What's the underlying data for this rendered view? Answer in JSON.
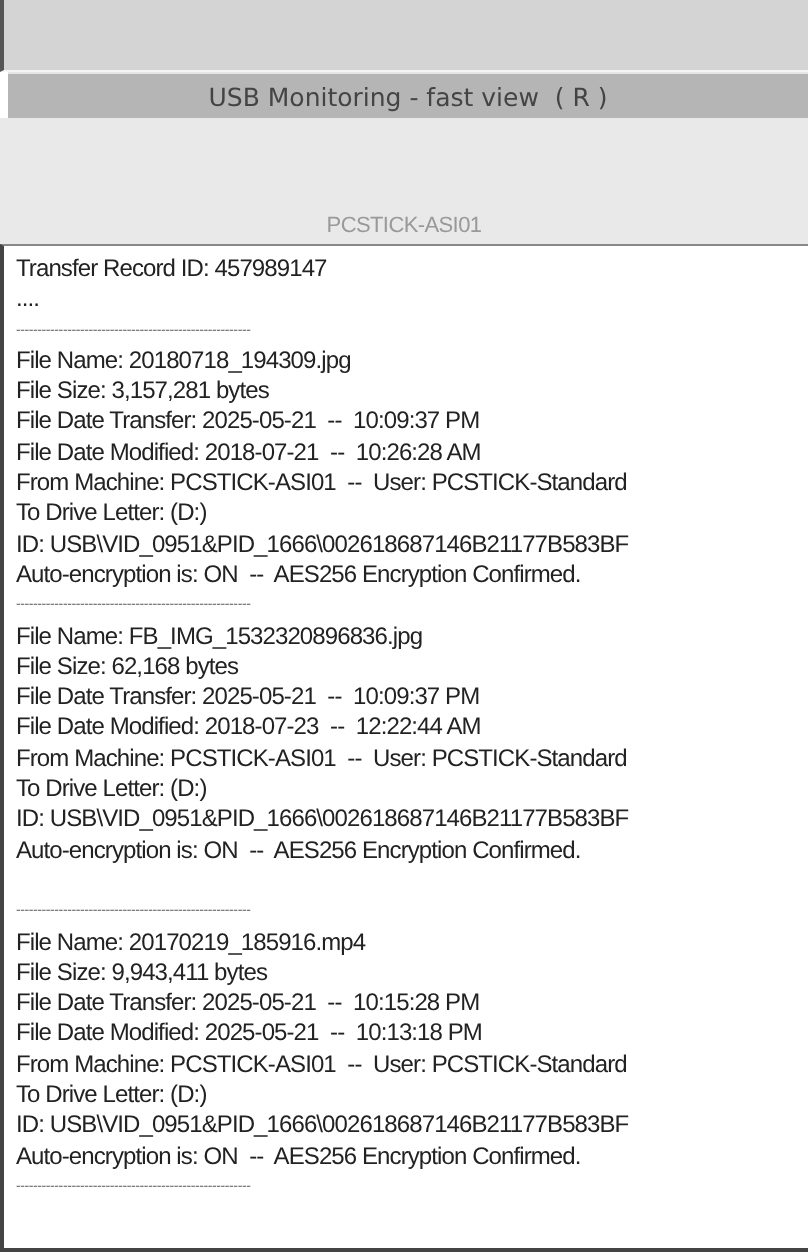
{
  "title_bar": {
    "title": "USB Monitoring - fast view  ( R )"
  },
  "machine_label": "PCSTICK-ASI01",
  "log_lines": [
    {
      "kind": "line",
      "text": "Transfer Record ID: 457989147"
    },
    {
      "kind": "line",
      "text": "...."
    },
    {
      "kind": "rule",
      "text": "-------------------------------------------------------"
    },
    {
      "kind": "line",
      "text": "File Name: 20180718_194309.jpg"
    },
    {
      "kind": "line",
      "text": "File Size: 3,157,281 bytes"
    },
    {
      "kind": "line",
      "text": "File Date Transfer: 2025-05-21  --  10:09:37 PM"
    },
    {
      "kind": "line",
      "text": "File Date Modified: 2018-07-21  --  10:26:28 AM"
    },
    {
      "kind": "line",
      "text": "From Machine: PCSTICK-ASI01  --  User: PCSTICK-Standard"
    },
    {
      "kind": "line",
      "text": "To Drive Letter: (D:)"
    },
    {
      "kind": "line",
      "text": "ID: USB\\VID_0951&PID_1666\\002618687146B21177B583BF"
    },
    {
      "kind": "line",
      "text": "Auto-encryption is: ON  --  AES256 Encryption Confirmed."
    },
    {
      "kind": "rule",
      "text": "-------------------------------------------------------"
    },
    {
      "kind": "line",
      "text": "File Name: FB_IMG_1532320896836.jpg"
    },
    {
      "kind": "line",
      "text": "File Size: 62,168 bytes"
    },
    {
      "kind": "line",
      "text": "File Date Transfer: 2025-05-21  --  10:09:37 PM"
    },
    {
      "kind": "line",
      "text": "File Date Modified: 2018-07-23  --  12:22:44 AM"
    },
    {
      "kind": "line",
      "text": "From Machine: PCSTICK-ASI01  --  User: PCSTICK-Standard"
    },
    {
      "kind": "line",
      "text": "To Drive Letter: (D:)"
    },
    {
      "kind": "line",
      "text": "ID: USB\\VID_0951&PID_1666\\002618687146B21177B583BF"
    },
    {
      "kind": "line",
      "text": "Auto-encryption is: ON  --  AES256 Encryption Confirmed."
    },
    {
      "kind": "gap"
    },
    {
      "kind": "rule",
      "text": "-------------------------------------------------------"
    },
    {
      "kind": "line",
      "text": "File Name: 20170219_185916.mp4"
    },
    {
      "kind": "line",
      "text": "File Size: 9,943,411 bytes"
    },
    {
      "kind": "line",
      "text": "File Date Transfer: 2025-05-21  --  10:15:28 PM"
    },
    {
      "kind": "line",
      "text": "File Date Modified: 2025-05-21  --  10:13:18 PM"
    },
    {
      "kind": "line",
      "text": "From Machine: PCSTICK-ASI01  --  User: PCSTICK-Standard"
    },
    {
      "kind": "line",
      "text": "To Drive Letter: (D:)"
    },
    {
      "kind": "line",
      "text": "ID: USB\\VID_0951&PID_1666\\002618687146B21177B583BF"
    },
    {
      "kind": "line",
      "text": "Auto-encryption is: ON  --  AES256 Encryption Confirmed."
    },
    {
      "kind": "rule",
      "text": "-------------------------------------------------------"
    }
  ]
}
